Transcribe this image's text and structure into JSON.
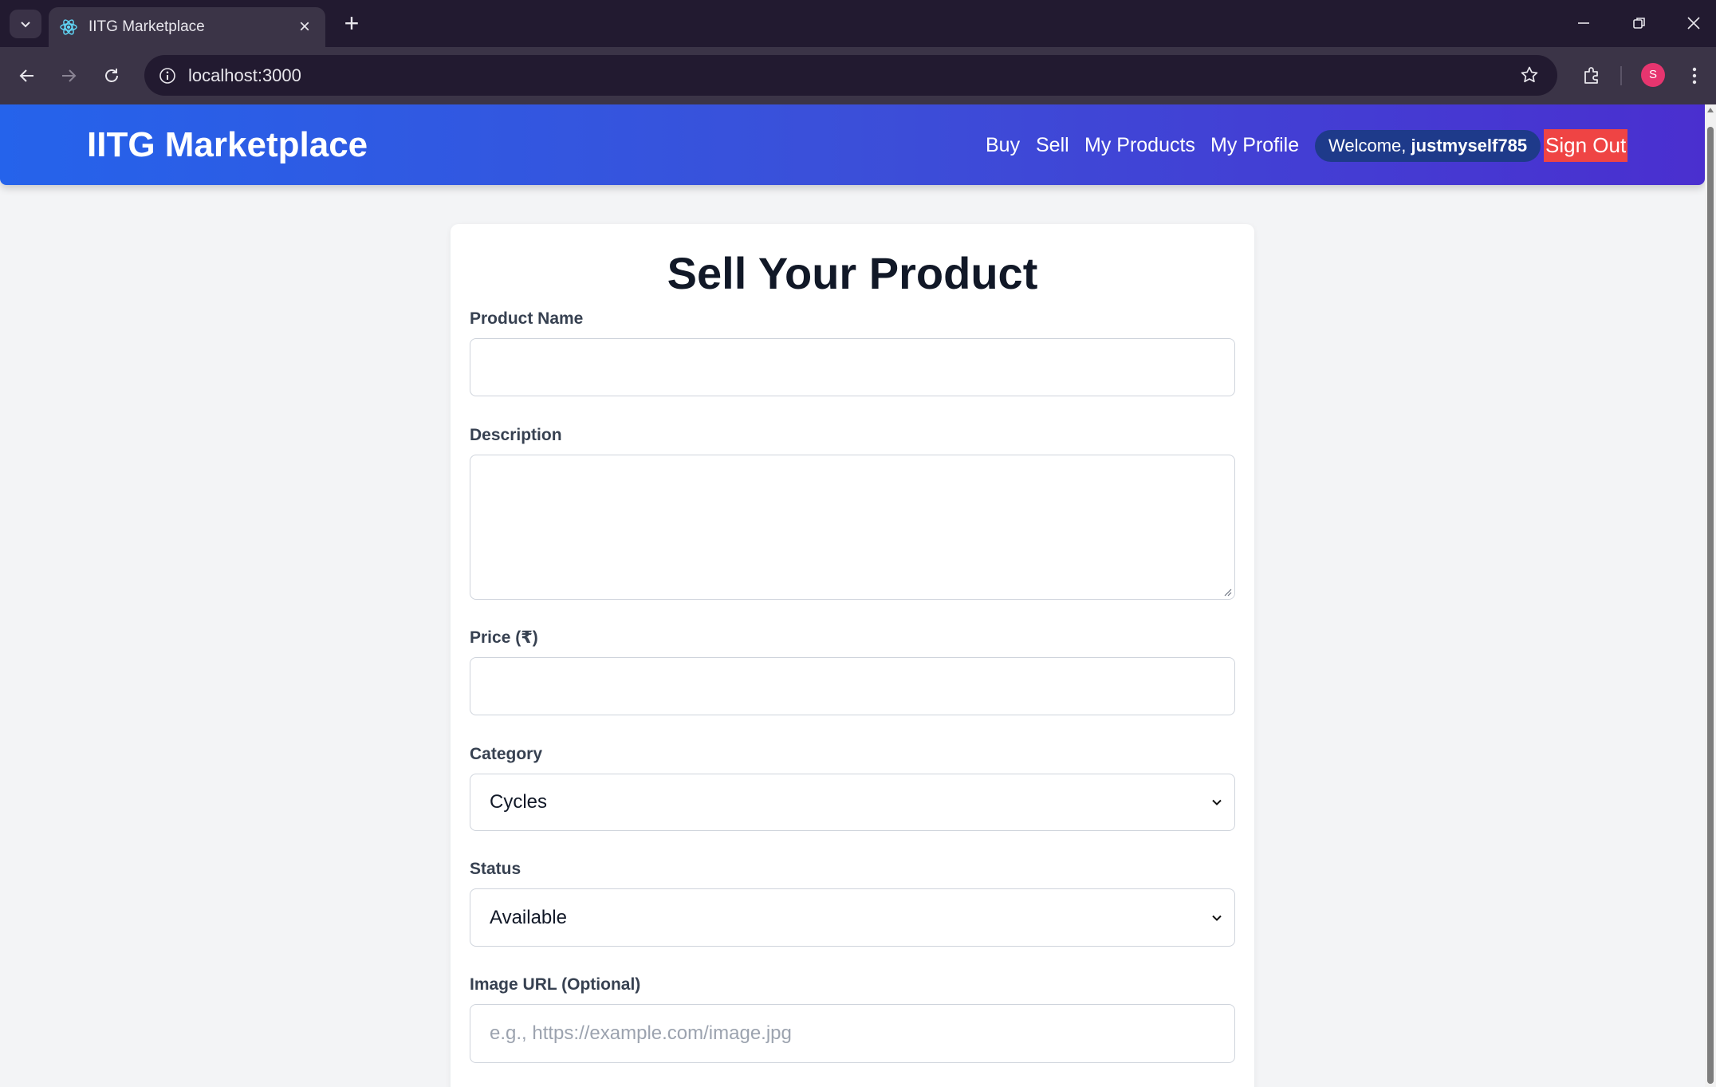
{
  "browser": {
    "tab_title": "IITG Marketplace",
    "url": "localhost:3000",
    "profile_initial": "S"
  },
  "header": {
    "brand": "IITG Marketplace",
    "nav": {
      "buy": "Buy",
      "sell": "Sell",
      "my_products": "My Products",
      "my_profile": "My Profile"
    },
    "welcome_prefix": "Welcome,",
    "username": "justmyself785",
    "signout": "Sign Out",
    "colors": {
      "gradient_start": "#2563eb",
      "gradient_end": "#4a2fcf",
      "welcome_bg": "#1e3a8a",
      "signout_bg": "#ef4444"
    }
  },
  "form": {
    "title": "Sell Your Product",
    "product_name": {
      "label": "Product Name",
      "value": ""
    },
    "description": {
      "label": "Description",
      "value": ""
    },
    "price": {
      "label": "Price (₹)",
      "value": ""
    },
    "category": {
      "label": "Category",
      "selected": "Cycles"
    },
    "status": {
      "label": "Status",
      "selected": "Available"
    },
    "image_url": {
      "label": "Image URL (Optional)",
      "value": "",
      "placeholder": "e.g., https://example.com/image.jpg"
    }
  },
  "icons": [
    "tab-list-icon",
    "react-icon",
    "close-icon",
    "plus-icon",
    "minimize-icon",
    "restore-icon",
    "back-icon",
    "forward-icon",
    "reload-icon",
    "info-icon",
    "star-icon",
    "extensions-icon",
    "kebab-menu-icon",
    "chevron-down-icon"
  ]
}
